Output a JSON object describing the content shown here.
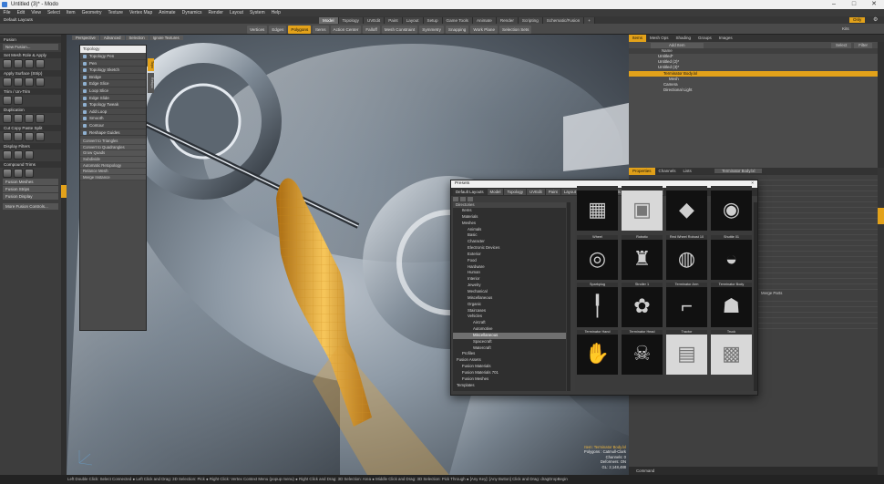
{
  "window": {
    "title": "Untitled (3)* - Modo",
    "min": "–",
    "max": "□",
    "close": "✕"
  },
  "menu": [
    "File",
    "Edit",
    "View",
    "Select",
    "Item",
    "Geometry",
    "Texture",
    "Vertex Map",
    "Animate",
    "Dynamics",
    "Render",
    "Layout",
    "System",
    "Help"
  ],
  "layout_select": "Default Layouts",
  "top_tabs": [
    "Model",
    "Topology",
    "UVEdit",
    "Paint",
    "Layout",
    "Setup",
    "Game Tools",
    "Animate",
    "Render",
    "Scripting",
    "Schematic/Fusion",
    "+"
  ],
  "top_right": {
    "only": "Only",
    "gear": "⚙"
  },
  "toolbar": [
    "Vertices",
    "Edges",
    "Polygons",
    "Items",
    "Action Center",
    "Falloff",
    "Mesh Constraint",
    "Symmetry",
    "Snapping",
    "Work Plane",
    "Selection Sets"
  ],
  "toolbar_active": "Polygons",
  "kits": "Kits",
  "left_panel": {
    "sections": [
      "Fusion",
      "Set Mesh Role & Apply",
      "Apply Surface (Strip)",
      "Trim / Un-Trim",
      "Duplication",
      "Cut Copy Paste Split",
      "Display Filters",
      "Compound Trims"
    ],
    "buttons": [
      "New Fusion...",
      "Fusion Meshes",
      "Fusion Strips",
      "Fusion Display",
      "More Fusion Controls..."
    ],
    "vtabs": [
      "Fusion",
      "Basic",
      "Curves",
      "Mesh Edit",
      "Fusion",
      "Duplicate",
      "Deform",
      "Vertex Map",
      "Particle"
    ]
  },
  "viewport": {
    "tabs": [
      "Perspective",
      "Advanced",
      "Selection",
      "Ignore Textures"
    ],
    "info": [
      "Item: Terminator Body.lxl",
      "Polygons : Catmull-Clark",
      "Channels: 0",
      "Deformers: ON",
      "GL: 2,148,488"
    ]
  },
  "topology_panel": {
    "title": "Topology",
    "items": [
      "Topology Pen",
      "Pen",
      "Topology Sketch",
      "Bridge",
      "Edge Slice",
      "Loop Slice",
      "Edge Slide",
      "Topology Tweak",
      "Add Loop",
      "Smooth",
      "Contour",
      "Reshape Guides"
    ],
    "subitems": [
      "Convert to Triangles",
      "Convert to Quadrangles",
      "Grow Quads",
      "Subdivide",
      "Automatic Retopology",
      "Relance Mesh",
      "Merge Instance"
    ],
    "side_tabs": [
      "Topo",
      "Retopo"
    ]
  },
  "right_panel": {
    "tabs": [
      "Items",
      "Mesh Ops",
      "Shading",
      "Groups",
      "Images"
    ],
    "add_item": "Add Item",
    "select_label": "Select",
    "filter_label": "Filter",
    "col_name": "Name",
    "items": [
      {
        "label": "Untitled*",
        "sel": false,
        "indent": 0
      },
      {
        "label": "Untitled (2)*",
        "sel": false,
        "indent": 0
      },
      {
        "label": "Untitled (3)*",
        "sel": false,
        "indent": 0
      },
      {
        "label": "Terminator Body.lxl",
        "sel": true,
        "indent": 1
      },
      {
        "label": "Mesh",
        "sel": false,
        "indent": 2
      },
      {
        "label": "Camera",
        "sel": false,
        "indent": 1
      },
      {
        "label": "Directional Light",
        "sel": false,
        "indent": 1
      }
    ],
    "prop_tabs": [
      "Properties",
      "Channels",
      "Lists"
    ],
    "prop_title": "Terminator Body.lxl",
    "merge_reset": "Merge Parts",
    "command": "Command"
  },
  "presets": {
    "title": "Presets",
    "layout": "Default Layouts",
    "tabs": [
      "Model",
      "Topology",
      "UVEdit",
      "Paint",
      "Layout",
      "Setup",
      "Game Tools",
      "Animate",
      "Render"
    ],
    "active_tab": "Render",
    "only": "Only",
    "dir_header": "Directories",
    "dirs": [
      {
        "label": "Items",
        "d": 1,
        "sel": false
      },
      {
        "label": "Materials",
        "d": 1,
        "sel": false
      },
      {
        "label": "Meshes",
        "d": 1,
        "sel": false
      },
      {
        "label": "Animals",
        "d": 2,
        "sel": false
      },
      {
        "label": "Basic",
        "d": 2,
        "sel": false
      },
      {
        "label": "Character",
        "d": 2,
        "sel": false
      },
      {
        "label": "Electronic Devices",
        "d": 2,
        "sel": false
      },
      {
        "label": "Exterior",
        "d": 2,
        "sel": false
      },
      {
        "label": "Food",
        "d": 2,
        "sel": false
      },
      {
        "label": "Hardware",
        "d": 2,
        "sel": false
      },
      {
        "label": "Human",
        "d": 2,
        "sel": false
      },
      {
        "label": "Interior",
        "d": 2,
        "sel": false
      },
      {
        "label": "Jewelry",
        "d": 2,
        "sel": false
      },
      {
        "label": "Mechanical",
        "d": 2,
        "sel": false
      },
      {
        "label": "Miscellaneous",
        "d": 2,
        "sel": false
      },
      {
        "label": "Organic",
        "d": 2,
        "sel": false
      },
      {
        "label": "Staircases",
        "d": 2,
        "sel": false
      },
      {
        "label": "Vehicles",
        "d": 2,
        "sel": false
      },
      {
        "label": "Aircraft",
        "d": 3,
        "sel": false
      },
      {
        "label": "Automotive",
        "d": 3,
        "sel": false
      },
      {
        "label": "Miscellaneous",
        "d": 3,
        "sel": true
      },
      {
        "label": "Spacecraft",
        "d": 3,
        "sel": false
      },
      {
        "label": "Watercraft",
        "d": 3,
        "sel": false
      },
      {
        "label": "Profiles",
        "d": 1,
        "sel": false
      },
      {
        "label": "Fusion Assets",
        "d": 0,
        "sel": false
      },
      {
        "label": "Fusion Materials",
        "d": 1,
        "sel": false
      },
      {
        "label": "Fusion Materials 701",
        "d": 1,
        "sel": false
      },
      {
        "label": "Fusion Meshes",
        "d": 1,
        "sel": false
      },
      {
        "label": "Templates",
        "d": 0,
        "sel": false
      }
    ],
    "thumbs": [
      {
        "label": "",
        "bg": "b"
      },
      {
        "label": "",
        "bg": "w"
      },
      {
        "label": "",
        "bg": "b"
      },
      {
        "label": "",
        "bg": "b"
      },
      {
        "label": "Wheel",
        "bg": "b"
      },
      {
        "label": "Robotic",
        "bg": "b"
      },
      {
        "label": "Red Wheel Robust 10",
        "bg": "b"
      },
      {
        "label": "Shuttle 01",
        "bg": "b"
      },
      {
        "label": "Sparkplug",
        "bg": "b"
      },
      {
        "label": "Stroller 1",
        "bg": "b"
      },
      {
        "label": "Terminator Arm",
        "bg": "b"
      },
      {
        "label": "Terminator Body",
        "bg": "b"
      },
      {
        "label": "Terminator Hand",
        "bg": "b"
      },
      {
        "label": "Terminator Head",
        "bg": "b"
      },
      {
        "label": "Tractor",
        "bg": "w"
      },
      {
        "label": "Truck",
        "bg": "w"
      }
    ]
  },
  "status": "Left Double Click: Select Connected ● Left Click and Drag: 3D Selection: Pick ● Right Click: Vertex Context Menu (popup menu) ● Right Click and Drag: 3D Selection: Area ● Middle Click and Drag: 3D Selection: Pick Through ● [Any Key]: [Any Button] Click and Drag: dragDropBegin"
}
